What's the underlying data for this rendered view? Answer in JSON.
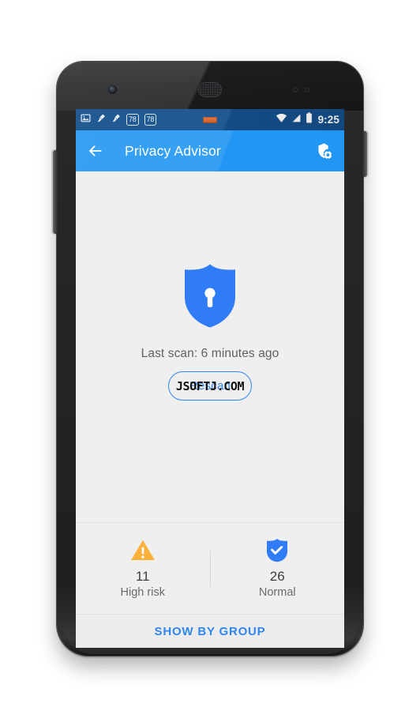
{
  "device": {
    "name": "android-phone",
    "hardware": {
      "front_camera": "camera-icon",
      "earpiece": "speaker-grille-icon",
      "sensor_proximity": "proximity-sensor-icon",
      "sensor_light": "light-sensor-icon",
      "volume_rocker": "volume-rocker-button",
      "power_button": "power-button"
    }
  },
  "status_bar": {
    "background_color": "#15508c",
    "left_icons": [
      {
        "name": "gallery-icon",
        "label": ""
      },
      {
        "name": "cleaner-brush-icon",
        "label": ""
      },
      {
        "name": "cleaner-brush-icon",
        "label": ""
      }
    ],
    "badges": [
      "78",
      "78"
    ],
    "center_indicator": "battery-charge-indicator",
    "right_icons": [
      {
        "name": "wifi-icon",
        "label": ""
      },
      {
        "name": "cellular-signal-icon",
        "label": ""
      },
      {
        "name": "battery-icon",
        "label": ""
      }
    ],
    "clock": "9:25"
  },
  "app_bar": {
    "back_icon": "back-arrow-icon",
    "title": "Privacy Advisor",
    "action_icon": "shield-settings-icon",
    "background_color": "#2196f3",
    "text_color": "#ffffff"
  },
  "scan_panel": {
    "shield_icon": "shield-lock-icon",
    "shield_color": "#2f7cf6",
    "last_scan_text": "Last scan: 6 minutes ago",
    "rescan_label": "Rescan",
    "rescan_color": "#2f86f0",
    "watermark": "JSOFTJ.COM"
  },
  "stats": [
    {
      "icon": "warning-triangle-icon",
      "icon_color": "#fbb03b",
      "count": "11",
      "label": "High risk"
    },
    {
      "icon": "shield-check-icon",
      "icon_color": "#2f7cf6",
      "count": "26",
      "label": "Normal"
    }
  ],
  "bottom_action": {
    "label": "SHOW BY GROUP",
    "color": "#2f86f0"
  },
  "nav_bar": {
    "buttons": [
      {
        "name": "nav-back-button",
        "icon": "back-triangle-icon"
      },
      {
        "name": "nav-home-button",
        "icon": "home-circle-icon"
      },
      {
        "name": "nav-recents-button",
        "icon": "recents-square-icon"
      }
    ]
  }
}
